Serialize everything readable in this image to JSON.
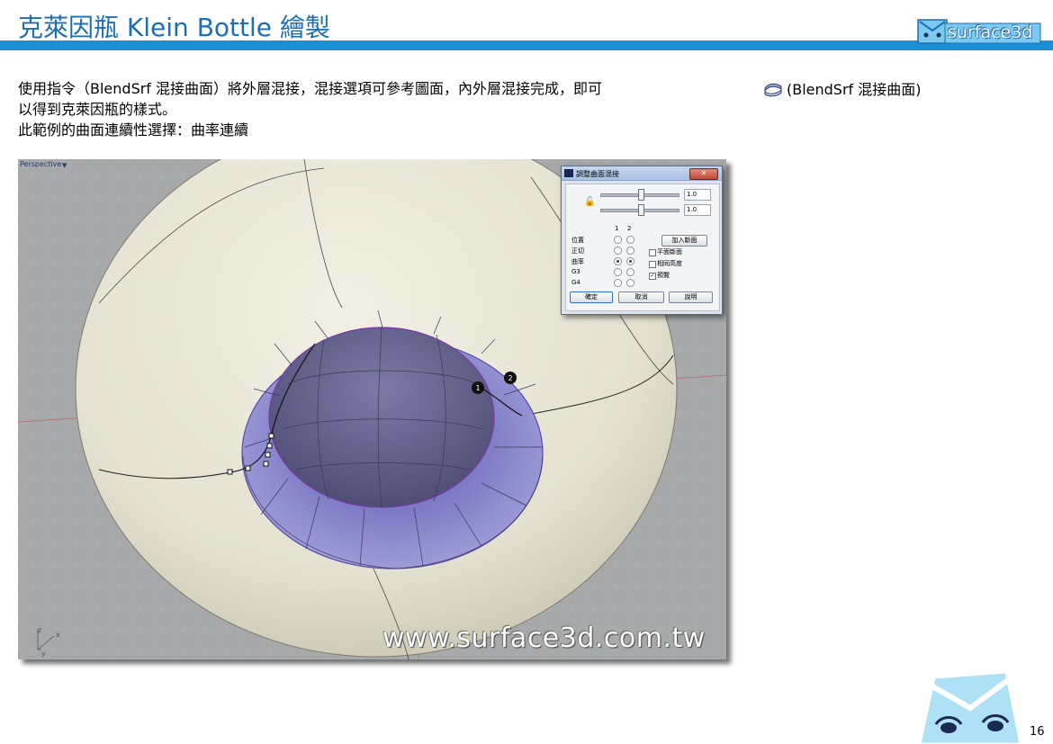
{
  "header": {
    "title": "克萊因瓶 Klein Bottle 繪製",
    "logo_text": "surface3d"
  },
  "body": {
    "lines": [
      "使用指令（BlendSrf 混接曲面）將外層混接，混接選項可參考圖面，內外層混接完成，即可",
      "以得到克萊因瓶的樣式。",
      "此範例的曲面連續性選擇：曲率連續"
    ],
    "command_ref": "(BlendSrf 混接曲面)",
    "command_icon": "blend-surface-icon"
  },
  "viewport": {
    "label": "Perspective",
    "menu_glyph": "▼",
    "watermark": "www.surface3d.com.tw",
    "axes": {
      "x": "x",
      "y": "y",
      "z": "z"
    },
    "point_markers": [
      "1",
      "2"
    ]
  },
  "dialog": {
    "title": "調整曲面混接",
    "close_glyph": "✕",
    "lock_icon": "lock-icon",
    "slider_values": [
      "1.0",
      "1.0"
    ],
    "column_headers": [
      "1",
      "2"
    ],
    "continuity_rows": [
      {
        "label": "位置",
        "sel1": false,
        "sel2": false
      },
      {
        "label": "正切",
        "sel1": false,
        "sel2": false
      },
      {
        "label": "曲率",
        "sel1": true,
        "sel2": true
      },
      {
        "label": "G3",
        "sel1": false,
        "sel2": false
      },
      {
        "label": "G4",
        "sel1": false,
        "sel2": false
      }
    ],
    "add_shape_button": "加入斷面",
    "checkboxes": [
      {
        "label": "平面斷面",
        "checked": false
      },
      {
        "label": "相同高度",
        "checked": false
      },
      {
        "label": "預覽",
        "checked": true
      }
    ],
    "ok_button": "確定",
    "cancel_button": "取消",
    "help_button": "說明"
  },
  "footer": {
    "page_number": "16"
  },
  "colors": {
    "brand_blue": "#1a8fd4",
    "title_blue": "#1a6fb4",
    "surface": "#e8e6d8",
    "blend_surface": "#9b9ad6",
    "viewport_bg": "#a7a9ab"
  }
}
